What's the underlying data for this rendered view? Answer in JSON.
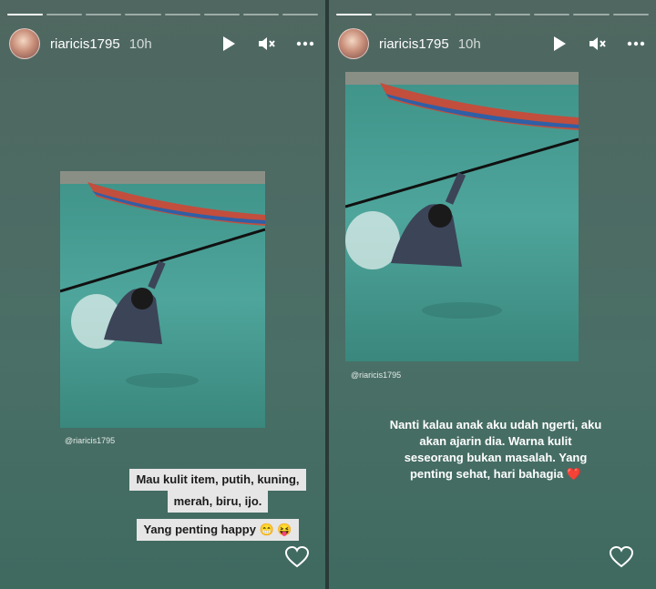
{
  "stories": [
    {
      "username": "riaricis1795",
      "time": "10h",
      "credit": "@riaricis1795",
      "sticker_lines": [
        "Mau kulit item, putih, kuning,",
        "merah, biru, ijo."
      ],
      "sticker_happy": "Yang penting happy 😁 😝"
    },
    {
      "username": "riaricis1795",
      "time": "10h",
      "credit": "@riaricis1795",
      "caption_lines": [
        "Nanti kalau anak aku udah ngerti, aku",
        "akan ajarin dia. Warna kulit",
        "seseorang bukan masalah. Yang",
        "penting sehat, hari bahagia ❤️"
      ]
    }
  ],
  "colors": {
    "background_top": "#4f6760",
    "background_bottom": "#3f6a60",
    "sticker": "#e6e6e6",
    "water": "#4a9a92"
  },
  "icons": [
    "play-icon",
    "mute-icon",
    "more-icon",
    "heart-icon"
  ]
}
